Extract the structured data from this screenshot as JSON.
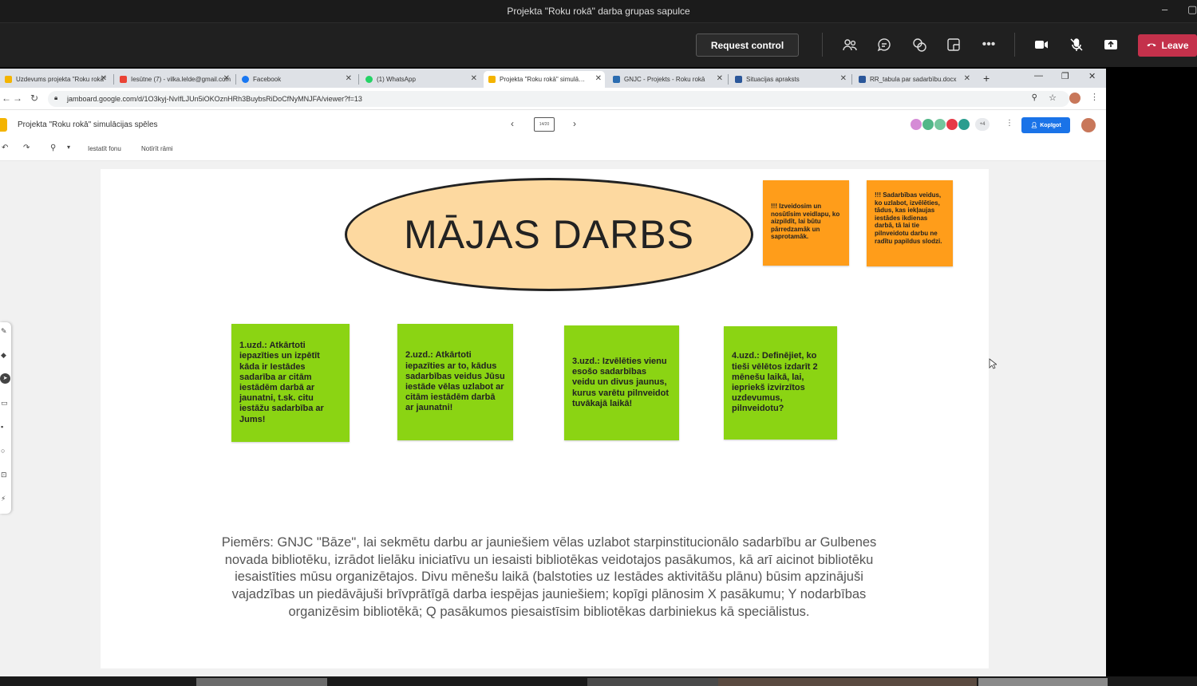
{
  "teams": {
    "meeting_title": "Projekta \"Roku rokā\" darba grupas sapulce",
    "request_control_label": "Request control",
    "leave_label": "Leave"
  },
  "browser": {
    "tabs": [
      {
        "label": "Uzdevums projekta \"Roku rokā\"",
        "favicon": "#f4b400"
      },
      {
        "label": "Iesūtne (7) - vilka.lelde@gmail.com",
        "favicon": "#ea4335"
      },
      {
        "label": "Facebook",
        "favicon": "#1877f2"
      },
      {
        "label": "(1) WhatsApp",
        "favicon": "#25d366"
      },
      {
        "label": "Projekta \"Roku rokā\" simulācijas spēles",
        "favicon": "#f4b400"
      },
      {
        "label": "GNJC - Projekts - Roku rokā",
        "favicon": "#2b6cb0"
      },
      {
        "label": "Situacijas apraksts",
        "favicon": "#2b579a"
      },
      {
        "label": "RR_tabula par sadarbību.docx",
        "favicon": "#2b579a"
      }
    ],
    "url": "jamboard.google.com/d/1O3kyj-NvIfLJUn5iOKOznHRh3BuybsRiDoCfNyMNJFA/viewer?f=13"
  },
  "jamboard": {
    "title": "Projekta \"Roku rokā\" simulācijas spēles",
    "frame_indicator": "14/20",
    "more_collaborators": "+4",
    "share_label": "Kopīgot",
    "toolbar": {
      "set_background": "Iestatīt fonu",
      "clear_frame": "Notīrīt rāmi"
    }
  },
  "board": {
    "heading": "MĀJAS DARBS",
    "orange_notes": [
      "!!! Izveidosim un nosūtīsim veidlapu, ko aizpildīt, lai būtu pārredzamāk un saprotamāk.",
      "!!! Sadarbības veidus, ko uzlabot, izvēlēties, tādus, kas iekļaujas iestādes ikdienas darbā, tā lai tie pilnveidotu darbu ne radītu papildus slodzi."
    ],
    "tasks": [
      "1.uzd.: Atkārtoti iepazīties un izpētīt kāda ir Iestādes sadarība ar citām iestādēm darbā ar jaunatni, t.sk. citu iestāžu sadarbība ar Jums!",
      "2.uzd.: Atkārtoti iepazīties ar to, kādus sadarbības veidus Jūsu iestāde vēlas uzlabot ar citām iestādēm darbā ar jaunatni!",
      "3.uzd.: Izvēlēties vienu esošo sadarbības veidu un divus jaunus, kurus varētu pilnveidot tuvākajā laikā!",
      "4.uzd.: Definējiet, ko tieši vēlētos izdarīt 2 mēnešu laikā, lai, iepriekš izvirzītos uzdevumus, pilnveidotu?"
    ],
    "example": "Piemērs: GNJC \"Bāze\", lai sekmētu darbu ar jauniešiem vēlas uzlabot starpinstitucionālo sadarbību ar Gulbenes novada bibliotēku, izrādot lielāku iniciatīvu un iesaisti bibliotēkas veidotajos pasākumos, kā arī aicinot bibliotēku iesaistīties mūsu organizētajos. Divu mēnešu laikā (balstoties uz Iestādes aktivitāšu plānu) būsim apzinājuši vajadzības un piedāvājuši brīvprātīgā darba iespējas jauniešiem; kopīgi plānosim X pasākumu; Y nodarbības organizēsim bibliotēkā; Q pasākumos piesaistīsim bibliotēkas darbiniekus kā speciālistus."
  },
  "colors": {
    "teams_bg": "#202020",
    "leave_red": "#c4314b",
    "sticky_orange": "#ff9d1a",
    "sticky_green": "#8bd413",
    "ellipse_fill": "#fdd9a0",
    "share_blue": "#1a73e8"
  }
}
